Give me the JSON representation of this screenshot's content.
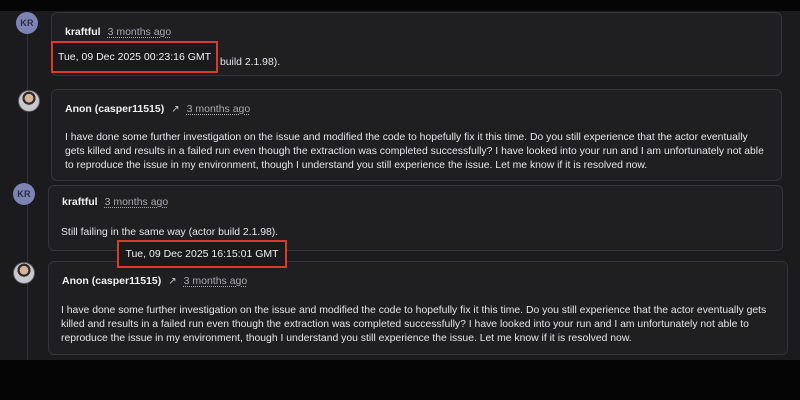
{
  "comments": [
    {
      "avatar_initials": "KR",
      "author": "kraftful",
      "time": "3 months ago",
      "body": "build 2.1.98)."
    },
    {
      "author": "Anon (casper11515)",
      "time": "3 months ago",
      "body": "I have done some further investigation on the issue and modified the code to hopefully fix it this time. Do you still experience that the actor eventually gets killed and results in a failed run even though the extraction was completed successfully? I have looked into your run and I am unfortunately not able to reproduce the issue in my environment, though I understand you still experience the issue. Let me know if it is resolved now."
    },
    {
      "avatar_initials": "KR",
      "author": "kraftful",
      "time": "3 months ago",
      "body": "Still failing in the same way (actor build 2.1.98)."
    },
    {
      "author": "Anon (casper11515)",
      "time": "3 months ago",
      "body": "I have done some further investigation on the issue and modified the code to hopefully fix it this time. Do you still experience that the actor eventually gets killed and results in a failed run even though the extraction was completed successfully? I have looked into your run and I am unfortunately not able to reproduce the issue in my environment, though I understand you still experience the issue. Let me know if it is resolved now."
    }
  ],
  "tooltips": [
    "Tue, 09 Dec 2025 00:23:16 GMT",
    "Tue, 09 Dec 2025 16:15:01 GMT"
  ],
  "icons": {
    "external_link": "↗"
  },
  "colors": {
    "highlight_border": "#d93a2b",
    "avatar_bg": "#7d84b5"
  }
}
